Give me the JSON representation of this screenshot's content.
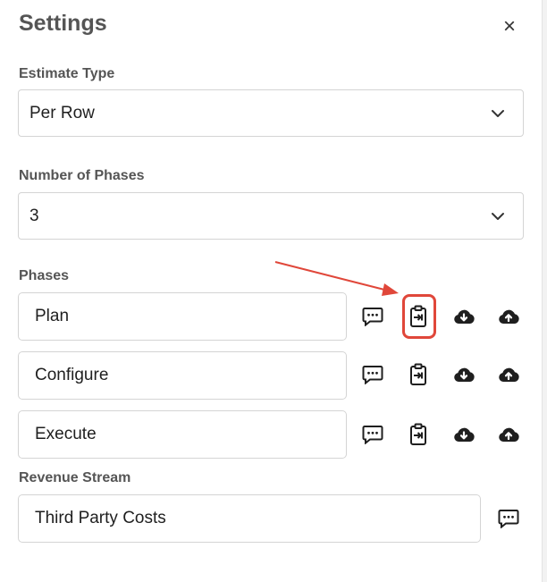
{
  "panel": {
    "title": "Settings",
    "close_label": "×"
  },
  "estimate_type": {
    "label": "Estimate Type",
    "value": "Per Row"
  },
  "number_of_phases": {
    "label": "Number of Phases",
    "value": "3"
  },
  "phases": {
    "label": "Phases",
    "items": [
      {
        "name": "Plan"
      },
      {
        "name": "Configure"
      },
      {
        "name": "Execute"
      }
    ]
  },
  "revenue_stream": {
    "label": "Revenue Stream",
    "value": "Third Party Costs"
  },
  "annotation": {
    "color": "#e0473a",
    "highlighted_icon": "clipboard-import-icon"
  },
  "icons": [
    "comment-icon",
    "clipboard-import-icon",
    "cloud-download-icon",
    "cloud-upload-icon",
    "chevron-down-icon",
    "close-icon"
  ]
}
